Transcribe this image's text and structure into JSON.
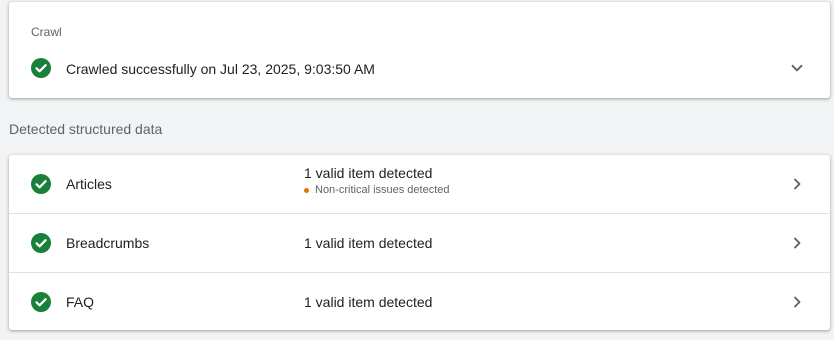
{
  "crawl": {
    "label": "Crawl",
    "status_text": "Crawled successfully on Jul 23, 2025, 9:03:50 AM",
    "status_icon": "check-circle-icon",
    "expand_icon": "chevron-down-icon"
  },
  "structured_data": {
    "title": "Detected structured data",
    "items": [
      {
        "name": "Articles",
        "status": "1 valid item detected",
        "note": "Non-critical issues detected",
        "icon": "check-circle-icon"
      },
      {
        "name": "Breadcrumbs",
        "status": "1 valid item detected",
        "icon": "check-circle-icon"
      },
      {
        "name": "FAQ",
        "status": "1 valid item detected",
        "icon": "check-circle-icon"
      }
    ]
  },
  "colors": {
    "success_green": "#188038",
    "warning_orange": "#e37400",
    "chevron_gray": "#5f6368",
    "background": "#f1f3f4"
  }
}
